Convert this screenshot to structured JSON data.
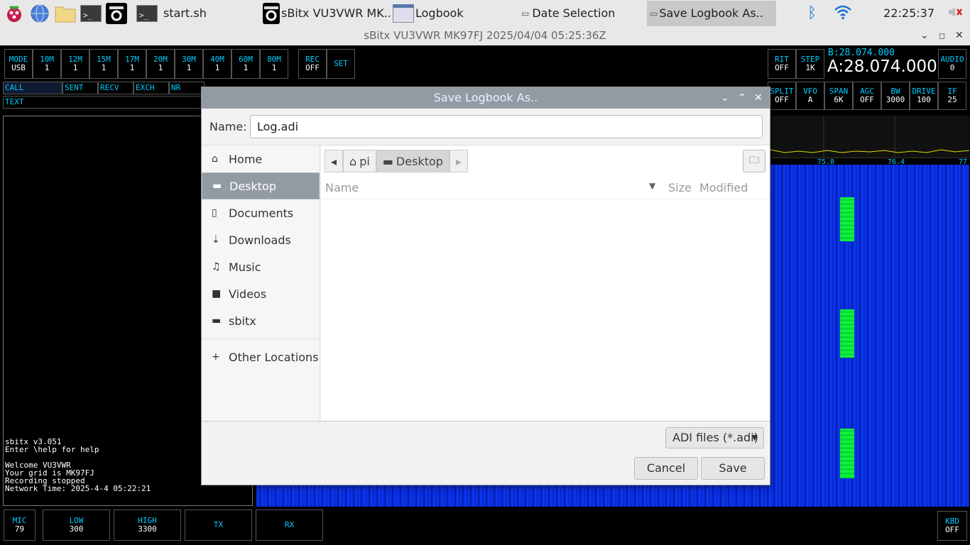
{
  "taskbar": {
    "tasks": [
      {
        "label": "start.sh"
      },
      {
        "label": "sBitx VU3VWR MK..."
      },
      {
        "label": "Logbook"
      },
      {
        "label": "Date Selection"
      },
      {
        "label": "Save Logbook As.."
      }
    ],
    "clock": "22:25:37"
  },
  "app": {
    "title": "sBitx VU3VWR MK97FJ 2025/04/04 05:25:36Z"
  },
  "radio": {
    "top_buttons": [
      {
        "label": "MODE",
        "value": "USB"
      },
      {
        "label": "10M",
        "value": "1"
      },
      {
        "label": "12M",
        "value": "1"
      },
      {
        "label": "15M",
        "value": "1"
      },
      {
        "label": "17M",
        "value": "1"
      },
      {
        "label": "20M",
        "value": "1"
      },
      {
        "label": "30M",
        "value": "1"
      },
      {
        "label": "40M",
        "value": "1"
      },
      {
        "label": "60M",
        "value": "1"
      },
      {
        "label": "80M",
        "value": "1"
      }
    ],
    "rec": {
      "label": "REC",
      "value": "OFF"
    },
    "set": "SET",
    "log_fields": [
      "CALL",
      "SENT",
      "RECV",
      "EXCH",
      "NR"
    ],
    "text_field": "TEXT",
    "rit": {
      "label": "RIT",
      "value": "OFF"
    },
    "step": {
      "label": "STEP",
      "value": "1K"
    },
    "vfo_b": "B:28.074.000",
    "vfo_a": "A:28.074.000",
    "audio": {
      "label": "AUDIO",
      "value": "0"
    },
    "right_buttons": [
      {
        "label": "SPLIT",
        "value": "OFF"
      },
      {
        "label": "VFO",
        "value": "A"
      },
      {
        "label": "SPAN",
        "value": "6K"
      },
      {
        "label": "AGC",
        "value": "OFF"
      },
      {
        "label": "BW",
        "value": "3000"
      },
      {
        "label": "DRIVE",
        "value": "100"
      },
      {
        "label": "IF",
        "value": "25"
      }
    ],
    "spectrum_ticks": [
      "75.8",
      "76.4",
      "77"
    ],
    "console_text": "sbitx v3.051\nEnter \\help for help\n\nWelcome VU3VWR\nYour grid is MK97FJ\nRecording stopped\nNetwork Time: 2025-4-4 05:22:21",
    "bottom_buttons": [
      {
        "label": "MIC",
        "value": "79"
      },
      {
        "label": "LOW",
        "value": "300"
      },
      {
        "label": "HIGH",
        "value": "3300"
      },
      {
        "label": "TX",
        "value": ""
      },
      {
        "label": "RX",
        "value": ""
      }
    ],
    "kbd": {
      "label": "KBD",
      "value": "OFF"
    }
  },
  "dialog": {
    "title": "Save Logbook As..",
    "name_label": "Name:",
    "name_value": "Log.adi",
    "places": [
      {
        "label": "Home",
        "icon": "home-icon"
      },
      {
        "label": "Desktop",
        "icon": "folder-icon"
      },
      {
        "label": "Documents",
        "icon": "document-icon"
      },
      {
        "label": "Downloads",
        "icon": "download-icon"
      },
      {
        "label": "Music",
        "icon": "music-icon"
      },
      {
        "label": "Videos",
        "icon": "video-icon"
      },
      {
        "label": "sbitx",
        "icon": "folder-icon"
      }
    ],
    "other_locations": "Other Locations",
    "path": [
      "pi",
      "Desktop"
    ],
    "columns": {
      "name": "Name",
      "size": "Size",
      "modified": "Modified"
    },
    "filter": "ADI files (*.adi)",
    "cancel": "Cancel",
    "save": "Save"
  }
}
